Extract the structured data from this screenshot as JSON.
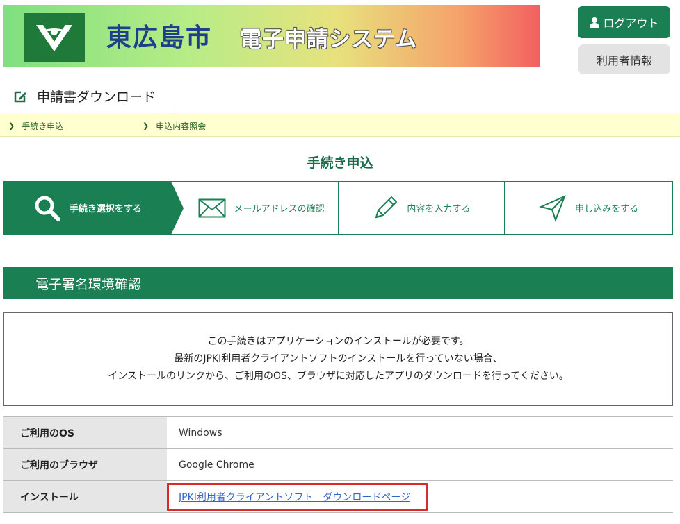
{
  "header": {
    "city": "東広島市",
    "system": "電子申請システム",
    "logout_label": "ログアウト",
    "userinfo_label": "利用者情報"
  },
  "download_tab": {
    "label": "申請書ダウンロード"
  },
  "nav": {
    "items": [
      {
        "label": "手続き申込"
      },
      {
        "label": "申込内容照会"
      }
    ]
  },
  "page_title": "手続き申込",
  "steps": [
    {
      "label": "手続き選択をする",
      "icon": "search-icon",
      "active": true
    },
    {
      "label": "メールアドレスの確認",
      "icon": "mail-icon",
      "active": false
    },
    {
      "label": "内容を入力する",
      "icon": "pencil-icon",
      "active": false
    },
    {
      "label": "申し込みをする",
      "icon": "send-icon",
      "active": false
    }
  ],
  "section": {
    "title": "電子署名環境確認"
  },
  "notice": {
    "lines": [
      "この手続きはアプリケーションのインストールが必要です。",
      "最新のJPKI利用者クライアントソフトのインストールを行っていない場合、",
      "インストールのリンクから、ご利用のOS、ブラウザに対応したアプリのダウンロードを行ってください。"
    ]
  },
  "table": {
    "rows": [
      {
        "label": "ご利用のOS",
        "value": "Windows"
      },
      {
        "label": "ご利用のブラウザ",
        "value": "Google Chrome"
      },
      {
        "label": "インストール",
        "value": "JPKI利用者クライアントソフト　ダウンロードページ"
      }
    ]
  },
  "colors": {
    "primary_green": "#1a7f52",
    "nav_bg": "#ffffcf",
    "highlight_red": "#d82c2c",
    "link_blue": "#3466c6"
  }
}
